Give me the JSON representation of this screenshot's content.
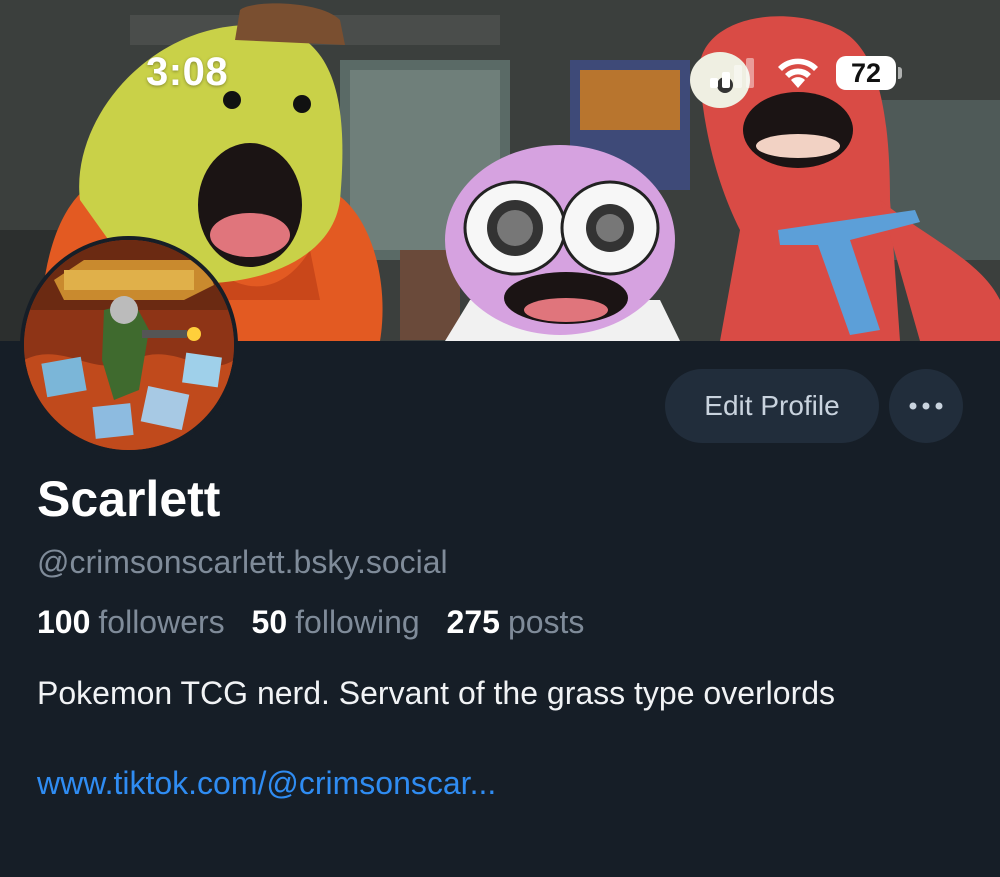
{
  "status_bar": {
    "time": "3:08",
    "battery_level": "72",
    "signal_icon": "cellular-signal-icon",
    "wifi_icon": "wifi-icon",
    "battery_icon": "battery-icon"
  },
  "profile": {
    "display_name": "Scarlett",
    "handle": "@crimsonscarlett.bsky.social",
    "stats": {
      "followers_count": "100",
      "followers_label": "followers",
      "following_count": "50",
      "following_label": "following",
      "posts_count": "275",
      "posts_label": "posts"
    },
    "bio": "Pokemon TCG nerd. Servant of the grass type overlords",
    "link": "www.tiktok.com/@crimsonscar..."
  },
  "actions": {
    "edit_profile_label": "Edit Profile",
    "more_icon": "ellipsis-icon"
  },
  "colors": {
    "background": "#161e27",
    "button_background": "#212d3b",
    "secondary_text": "#7f8b99",
    "link": "#2f8cf2"
  }
}
